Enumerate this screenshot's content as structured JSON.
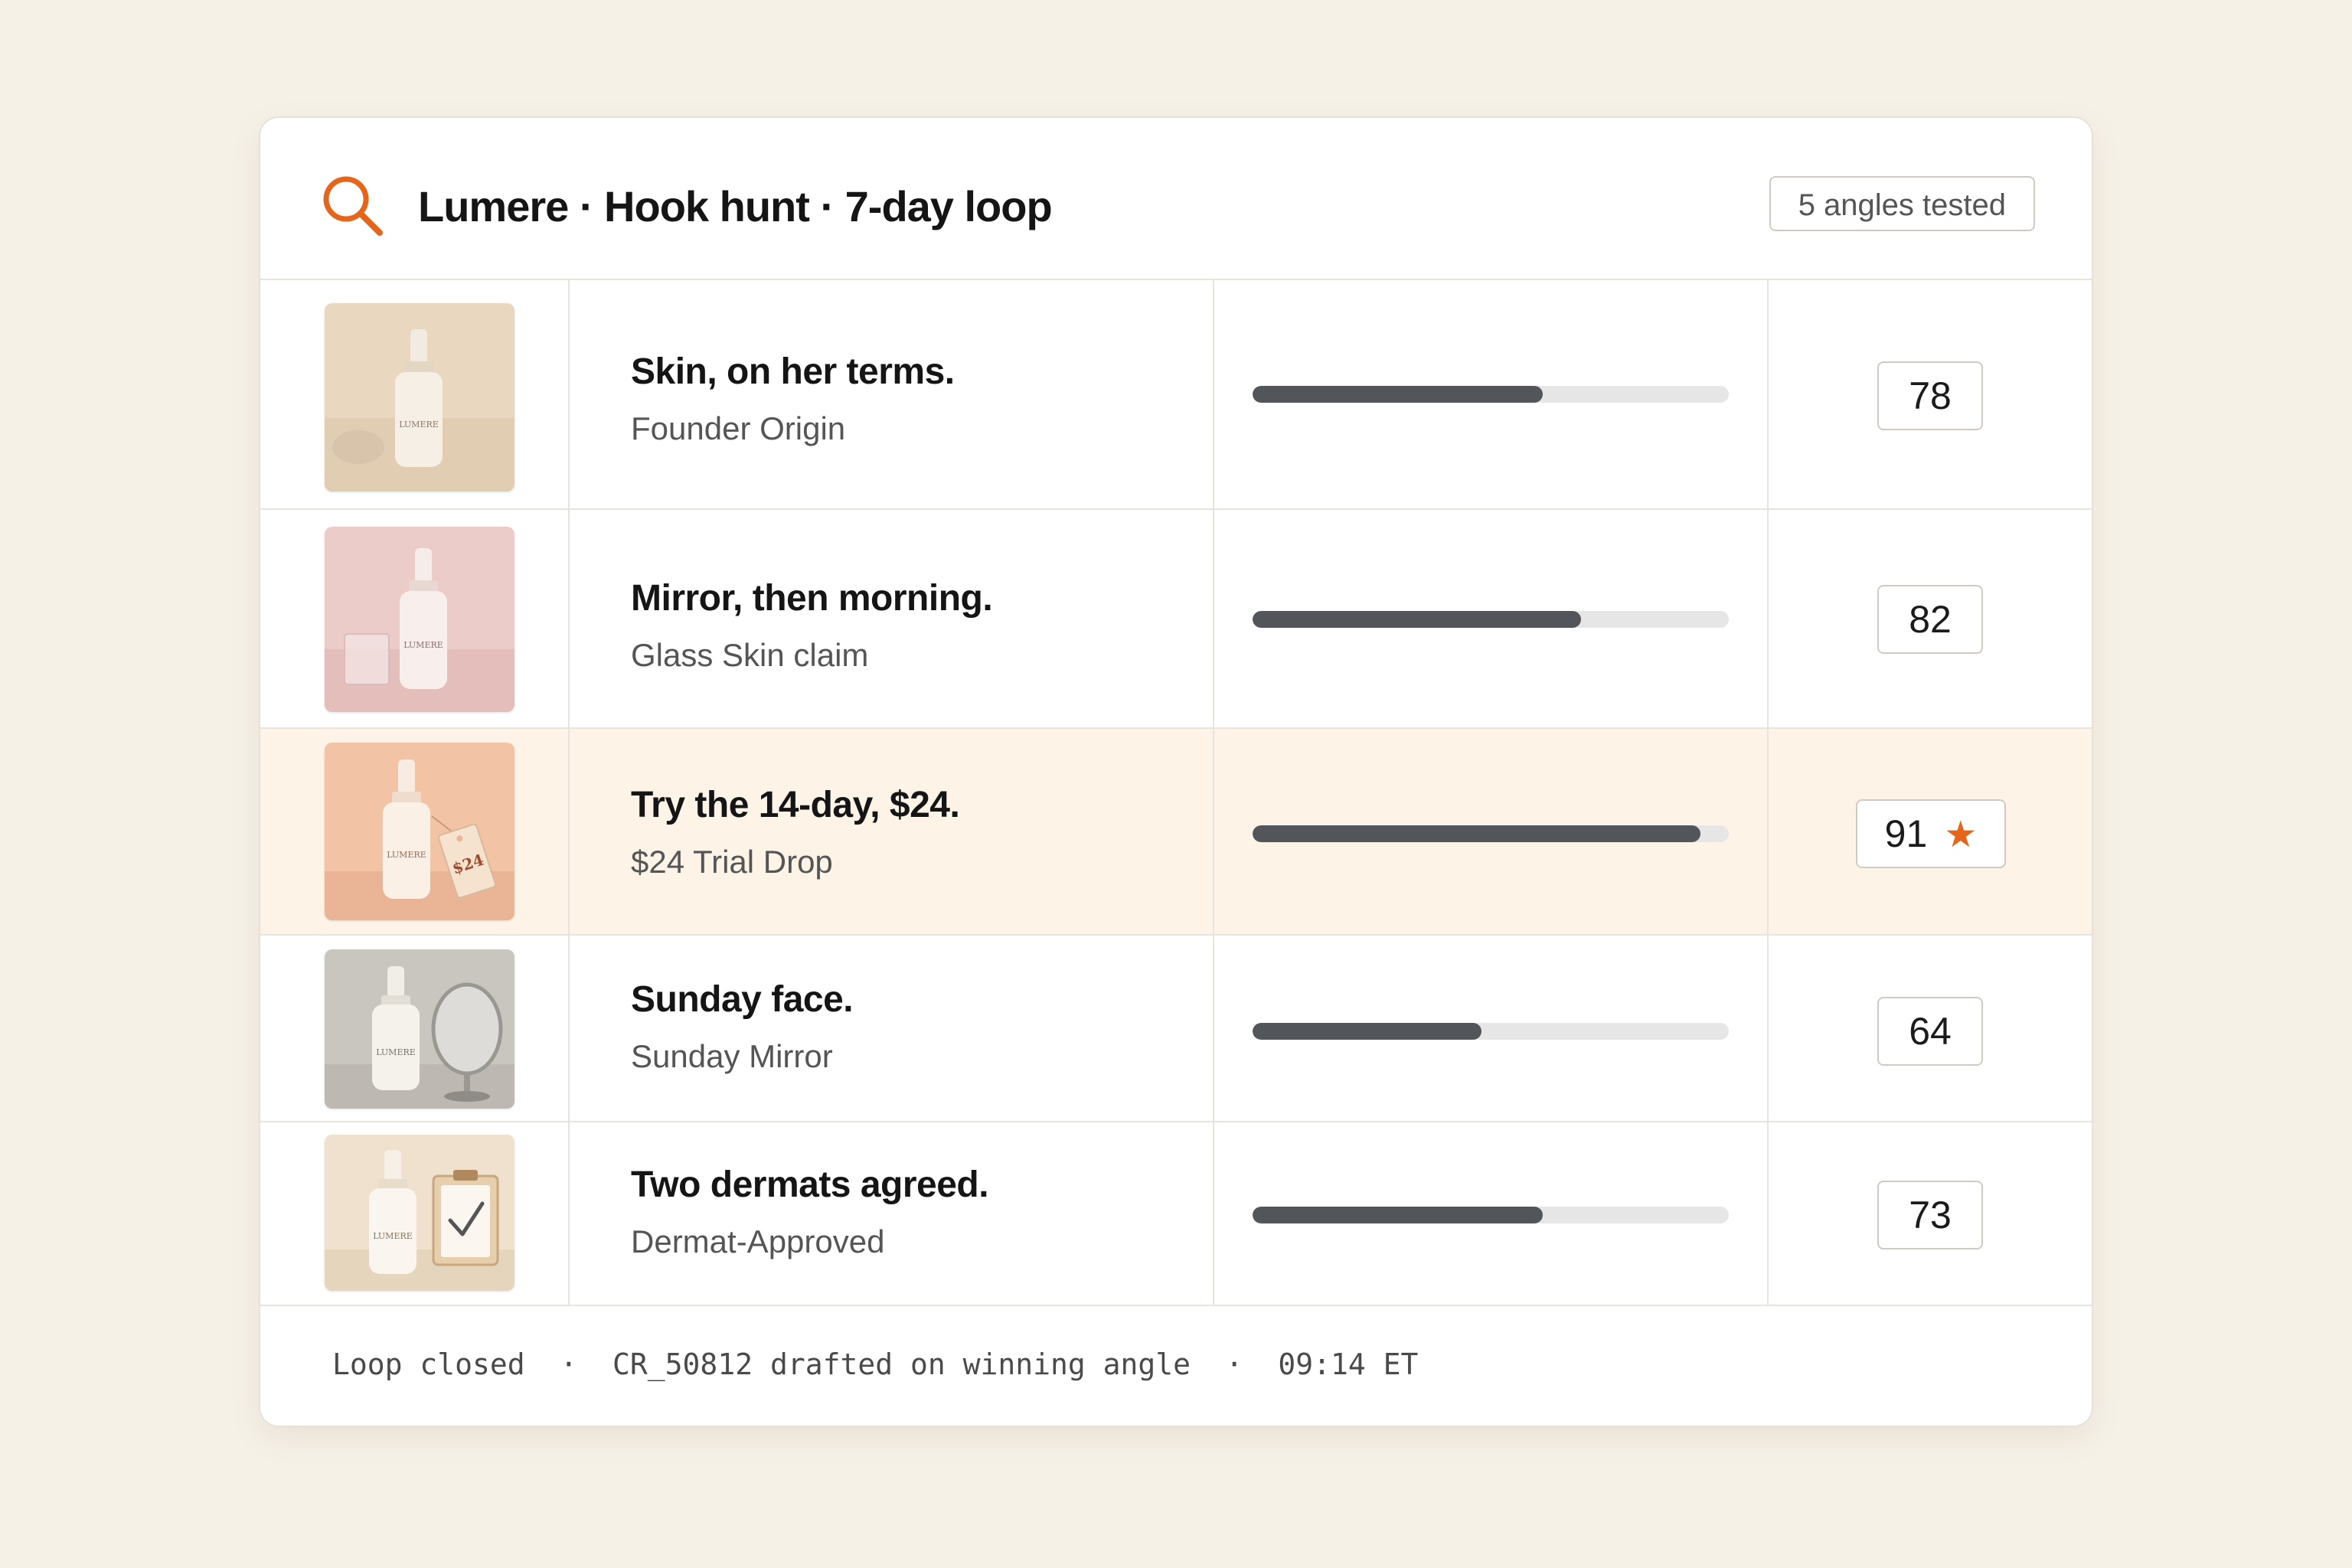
{
  "header": {
    "title": "Lumere · Hook hunt · 7-day loop",
    "badge": "5 angles tested",
    "accent_color": "#e5661b"
  },
  "rows": [
    {
      "headline": "Skin, on her terms.",
      "angle": "Founder Origin",
      "score": "78",
      "progress": 0.61,
      "image": "serum-bottle-with-stone-beige",
      "winner": false
    },
    {
      "headline": "Mirror, then morning.",
      "angle": "Glass Skin claim",
      "score": "82",
      "progress": 0.69,
      "image": "serum-bottle-with-glass-cube-pink",
      "winner": false
    },
    {
      "headline": "Try the 14-day, $24.",
      "angle": "$24 Trial Drop",
      "score": "91",
      "progress": 0.94,
      "image": "serum-bottle-with-price-tag-peach",
      "tag_text": "$24",
      "winner": true,
      "winner_icon": "star-icon"
    },
    {
      "headline": "Sunday face.",
      "angle": "Sunday Mirror",
      "score": "64",
      "progress": 0.48,
      "image": "serum-bottle-with-mirror-gray",
      "winner": false
    },
    {
      "headline": "Two dermats agreed.",
      "angle": "Dermat-Approved",
      "score": "73",
      "progress": 0.61,
      "image": "serum-bottle-with-clipboard-check",
      "winner": false
    }
  ],
  "brand_label": "LUMERE",
  "footer": {
    "text": "Loop closed  ·  CR_50812 drafted on winning angle  ·  09:14 ET"
  }
}
